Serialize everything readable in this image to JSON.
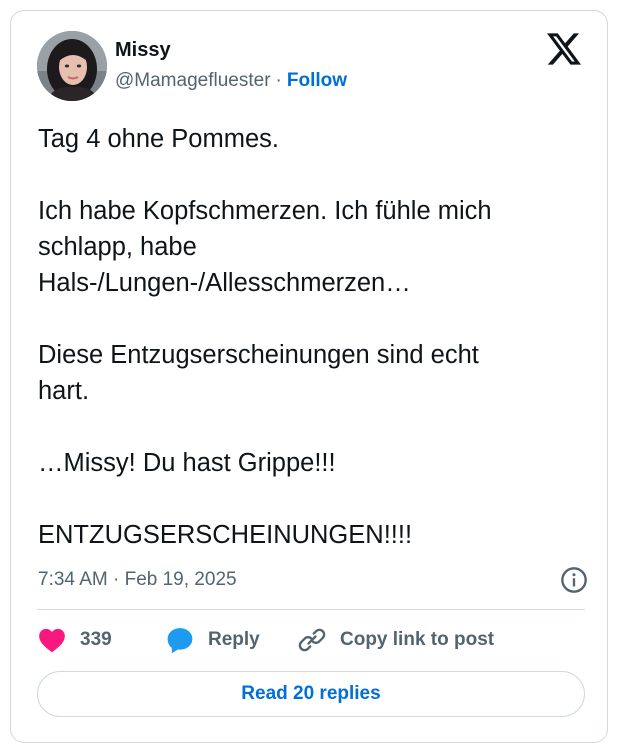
{
  "author": {
    "name": "Missy",
    "handle": "@Mamagefluester",
    "separator": "·",
    "follow_label": "Follow"
  },
  "tweet": {
    "paragraphs": [
      [
        "Tag 4 ohne Pommes."
      ],
      [
        "Ich habe Kopfschmerzen. Ich fühle mich",
        "schlapp, habe",
        "Hals-/Lungen-/Allesschmerzen…"
      ],
      [
        "Diese Entzugserscheinungen sind echt",
        "hart."
      ],
      [
        "…Missy! Du hast Grippe!!!"
      ],
      [
        "ENTZUGSERSCHEINUNGEN!!!!"
      ]
    ],
    "timestamp": "7:34 AM · Feb 19, 2025"
  },
  "actions": {
    "like_count": "339",
    "reply_label": "Reply",
    "copy_label": "Copy link to post"
  },
  "read_replies_label": "Read 20 replies",
  "icons": {
    "platform": "x-logo-icon",
    "info": "info-icon",
    "like": "heart-icon",
    "reply": "speech-bubble-icon",
    "copy": "link-icon"
  },
  "colors": {
    "accent": "#006fd6",
    "like": "#f91880",
    "reply": "#1d9bf0",
    "muted": "#536471",
    "border": "#cfd9de"
  }
}
